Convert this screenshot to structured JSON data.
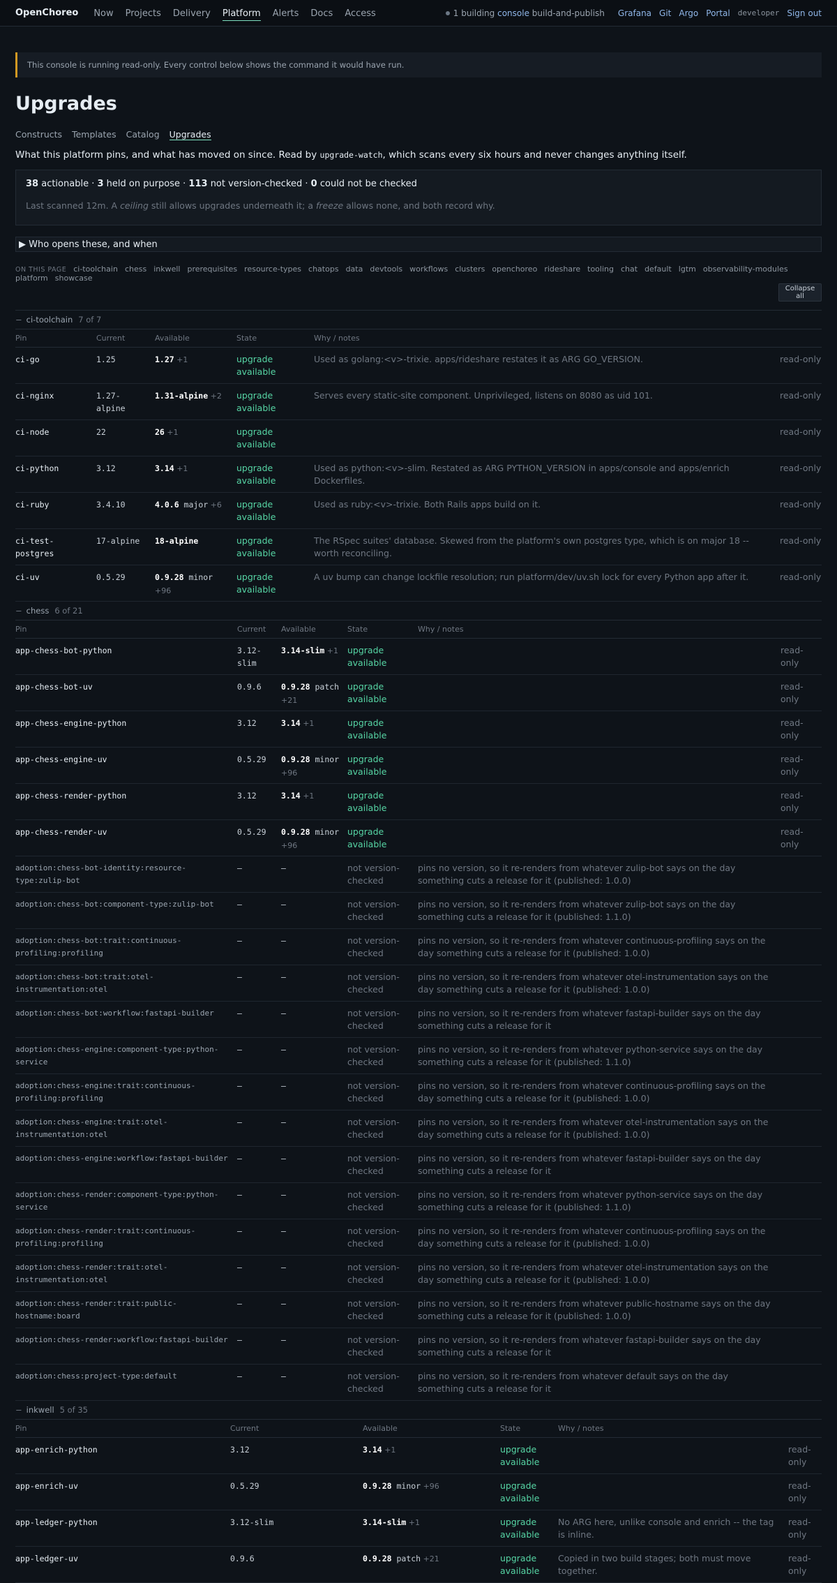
{
  "nav": {
    "brand": "OpenChoreo",
    "items": [
      "Now",
      "Projects",
      "Delivery",
      "Platform",
      "Alerts",
      "Docs",
      "Access"
    ],
    "active": "Platform",
    "status": {
      "count": "1 building",
      "target": "console",
      "stage": "build-and-publish"
    },
    "links": [
      "Grafana",
      "Git",
      "Argo",
      "Portal"
    ],
    "user": "developer",
    "signout": "Sign out"
  },
  "banner": "This console is running read-only. Every control below shows the command it would have run.",
  "title": "Upgrades",
  "subnav": [
    "Constructs",
    "Templates",
    "Catalog",
    "Upgrades"
  ],
  "intro": {
    "pre": "What this platform pins, and what has moved on since. Read by ",
    "code": "upgrade-watch",
    "post": ", which scans every six hours and never changes anything itself."
  },
  "summary": {
    "actionable": "38",
    "actionable_label": " actionable · ",
    "held": "3",
    "held_label": " held on purpose · ",
    "unchecked": "113",
    "unchecked_label": " not version-checked · ",
    "failed": "0",
    "failed_label": " could not be checked",
    "note_pre": "Last scanned 12m. A ",
    "ceiling": "ceiling",
    "note_mid": " still allows upgrades underneath it; a ",
    "freeze": "freeze",
    "note_post": " allows none, and both record why."
  },
  "who": "Who opens these, and when",
  "onpage": {
    "label": "ON THIS PAGE",
    "links": [
      "ci-toolchain",
      "chess",
      "inkwell",
      "prerequisites",
      "resource-types",
      "chatops",
      "data",
      "devtools",
      "workflows",
      "clusters",
      "openchoreo",
      "rideshare",
      "tooling",
      "chat",
      "default",
      "lgtm",
      "observability-modules",
      "platform",
      "showcase"
    ],
    "collapse": "Collapse all"
  },
  "columns": {
    "pin": "Pin",
    "current": "Current",
    "available": "Available",
    "state": "State",
    "why": "Why / notes"
  },
  "sections": [
    {
      "name": "ci-toolchain",
      "count": "7 of 7",
      "toggle": "−",
      "widths": [
        116,
        84,
        117,
        111,
        668,
        60
      ],
      "rows": [
        {
          "pin": "ci-go",
          "current": "1.25",
          "available": "1.27",
          "extra": "+1",
          "state": "upgrade available",
          "why": "Used as golang:<v>-trixie. apps/rideshare restates it as ARG GO_VERSION.",
          "action": "read-only"
        },
        {
          "pin": "ci-nginx",
          "current": "1.27-alpine",
          "available": "1.31-alpine",
          "extra": "+2",
          "state": "upgrade available",
          "why": "Serves every static-site component. Unprivileged, listens on 8080 as uid 101.",
          "action": "read-only"
        },
        {
          "pin": "ci-node",
          "current": "22",
          "available": "26",
          "extra": "+1",
          "state": "upgrade available",
          "why": "",
          "action": "read-only"
        },
        {
          "pin": "ci-python",
          "current": "3.12",
          "available": "3.14",
          "extra": "+1",
          "state": "upgrade available",
          "why": "Used as python:<v>-slim. Restated as ARG PYTHON_VERSION in apps/console and apps/enrich Dockerfiles.",
          "action": "read-only"
        },
        {
          "pin": "ci-ruby",
          "current": "3.4.10",
          "available": "4.0.6",
          "kind": "major",
          "extra": "+6",
          "state": "upgrade available",
          "why": "Used as ruby:<v>-trixie. Both Rails apps build on it.",
          "action": "read-only"
        },
        {
          "pin": "ci-test-postgres",
          "current": "17-alpine",
          "available": "18-alpine",
          "extra": "",
          "state": "upgrade available",
          "why": "The RSpec suites' database. Skewed from the platform's own postgres type, which is on major 18 -- worth reconciling.",
          "action": "read-only"
        },
        {
          "pin": "ci-uv",
          "current": "0.5.29",
          "available": "0.9.28",
          "kind": "minor",
          "extra": "+96",
          "state": "upgrade available",
          "why": "A uv bump can change lockfile resolution; run platform/dev/uv.sh lock for every Python app after it.",
          "action": "read-only"
        }
      ]
    },
    {
      "name": "chess",
      "count": "6 of 21",
      "toggle": "−",
      "widths": [
        318,
        63,
        95,
        101,
        520,
        59
      ],
      "rows": [
        {
          "pin": "app-chess-bot-python",
          "current": "3.12-slim",
          "available": "3.14-slim",
          "extra": "+1",
          "state": "upgrade available",
          "why": "",
          "action": "read-only"
        },
        {
          "pin": "app-chess-bot-uv",
          "current": "0.9.6",
          "available": "0.9.28",
          "kind": "patch",
          "extra": "+21",
          "state": "upgrade available",
          "why": "",
          "action": "read-only"
        },
        {
          "pin": "app-chess-engine-python",
          "current": "3.12",
          "available": "3.14",
          "extra": "+1",
          "state": "upgrade available",
          "why": "",
          "action": "read-only"
        },
        {
          "pin": "app-chess-engine-uv",
          "current": "0.5.29",
          "available": "0.9.28",
          "kind": "minor",
          "extra": "+96",
          "state": "upgrade available",
          "why": "",
          "action": "read-only"
        },
        {
          "pin": "app-chess-render-python",
          "current": "3.12",
          "available": "3.14",
          "extra": "+1",
          "state": "upgrade available",
          "why": "",
          "action": "read-only"
        },
        {
          "pin": "app-chess-render-uv",
          "current": "0.5.29",
          "available": "0.9.28",
          "kind": "minor",
          "extra": "+96",
          "state": "upgrade available",
          "why": "",
          "action": "read-only"
        },
        {
          "pin": "adoption:chess-bot-identity:resource-type:zulip-bot",
          "current": "—",
          "available": "—",
          "state": "not version-checked",
          "why": "pins no version, so it re-renders from whatever zulip-bot says on the day something cuts a release for it (published: 1.0.0)",
          "action": "",
          "adopt": true
        },
        {
          "pin": "adoption:chess-bot:component-type:zulip-bot",
          "current": "—",
          "available": "—",
          "state": "not version-checked",
          "why": "pins no version, so it re-renders from whatever zulip-bot says on the day something cuts a release for it (published: 1.1.0)",
          "action": "",
          "adopt": true
        },
        {
          "pin": "adoption:chess-bot:trait:continuous-profiling:profiling",
          "current": "—",
          "available": "—",
          "state": "not version-checked",
          "why": "pins no version, so it re-renders from whatever continuous-profiling says on the day something cuts a release for it (published: 1.0.0)",
          "action": "",
          "adopt": true
        },
        {
          "pin": "adoption:chess-bot:trait:otel-instrumentation:otel",
          "current": "—",
          "available": "—",
          "state": "not version-checked",
          "why": "pins no version, so it re-renders from whatever otel-instrumentation says on the day something cuts a release for it (published: 1.0.0)",
          "action": "",
          "adopt": true
        },
        {
          "pin": "adoption:chess-bot:workflow:fastapi-builder",
          "current": "—",
          "available": "—",
          "state": "not version-checked",
          "why": "pins no version, so it re-renders from whatever fastapi-builder says on the day something cuts a release for it",
          "action": "",
          "adopt": true
        },
        {
          "pin": "adoption:chess-engine:component-type:python-service",
          "current": "—",
          "available": "—",
          "state": "not version-checked",
          "why": "pins no version, so it re-renders from whatever python-service says on the day something cuts a release for it (published: 1.1.0)",
          "action": "",
          "adopt": true
        },
        {
          "pin": "adoption:chess-engine:trait:continuous-profiling:profiling",
          "current": "—",
          "available": "—",
          "state": "not version-checked",
          "why": "pins no version, so it re-renders from whatever continuous-profiling says on the day something cuts a release for it (published: 1.0.0)",
          "action": "",
          "adopt": true
        },
        {
          "pin": "adoption:chess-engine:trait:otel-instrumentation:otel",
          "current": "—",
          "available": "—",
          "state": "not version-checked",
          "why": "pins no version, so it re-renders from whatever otel-instrumentation says on the day something cuts a release for it (published: 1.0.0)",
          "action": "",
          "adopt": true
        },
        {
          "pin": "adoption:chess-engine:workflow:fastapi-builder",
          "current": "—",
          "available": "—",
          "state": "not version-checked",
          "why": "pins no version, so it re-renders from whatever fastapi-builder says on the day something cuts a release for it",
          "action": "",
          "adopt": true
        },
        {
          "pin": "adoption:chess-render:component-type:python-service",
          "current": "—",
          "available": "—",
          "state": "not version-checked",
          "why": "pins no version, so it re-renders from whatever python-service says on the day something cuts a release for it (published: 1.1.0)",
          "action": "",
          "adopt": true
        },
        {
          "pin": "adoption:chess-render:trait:continuous-profiling:profiling",
          "current": "—",
          "available": "—",
          "state": "not version-checked",
          "why": "pins no version, so it re-renders from whatever continuous-profiling says on the day something cuts a release for it (published: 1.0.0)",
          "action": "",
          "adopt": true
        },
        {
          "pin": "adoption:chess-render:trait:otel-instrumentation:otel",
          "current": "—",
          "available": "—",
          "state": "not version-checked",
          "why": "pins no version, so it re-renders from whatever otel-instrumentation says on the day something cuts a release for it (published: 1.0.0)",
          "action": "",
          "adopt": true
        },
        {
          "pin": "adoption:chess-render:trait:public-hostname:board",
          "current": "—",
          "available": "—",
          "state": "not version-checked",
          "why": "pins no version, so it re-renders from whatever public-hostname says on the day something cuts a release for it (published: 1.0.0)",
          "action": "",
          "adopt": true
        },
        {
          "pin": "adoption:chess-render:workflow:fastapi-builder",
          "current": "—",
          "available": "—",
          "state": "not version-checked",
          "why": "pins no version, so it re-renders from whatever fastapi-builder says on the day something cuts a release for it",
          "action": "",
          "adopt": true
        },
        {
          "pin": "adoption:chess:project-type:default",
          "current": "—",
          "available": "—",
          "state": "not version-checked",
          "why": "pins no version, so it re-renders from whatever default says on the day something cuts a release for it",
          "action": "",
          "adopt": true
        }
      ]
    },
    {
      "name": "inkwell",
      "count": "5 of 35",
      "toggle": "−",
      "widths": [
        308,
        190,
        197,
        83,
        330,
        48
      ],
      "rows": [
        {
          "pin": "app-enrich-python",
          "current": "3.12",
          "available": "3.14",
          "extra": "+1",
          "state": "upgrade available",
          "why": "",
          "action": "read-only"
        },
        {
          "pin": "app-enrich-uv",
          "current": "0.5.29",
          "available": "0.9.28",
          "kind": "minor",
          "extra": "+96",
          "state": "upgrade available",
          "why": "",
          "action": "read-only"
        },
        {
          "pin": "app-ledger-python",
          "current": "3.12-slim",
          "available": "3.14-slim",
          "extra": "+1",
          "state": "upgrade available",
          "why": "No ARG here, unlike console and enrich -- the tag is inline.",
          "action": "read-only"
        },
        {
          "pin": "app-ledger-uv",
          "current": "0.9.6",
          "available": "0.9.28",
          "kind": "patch",
          "extra": "+21",
          "state": "upgrade available",
          "why": "Copied in two build stages; both must move together.",
          "action": "read-only"
        }
      ]
    }
  ]
}
